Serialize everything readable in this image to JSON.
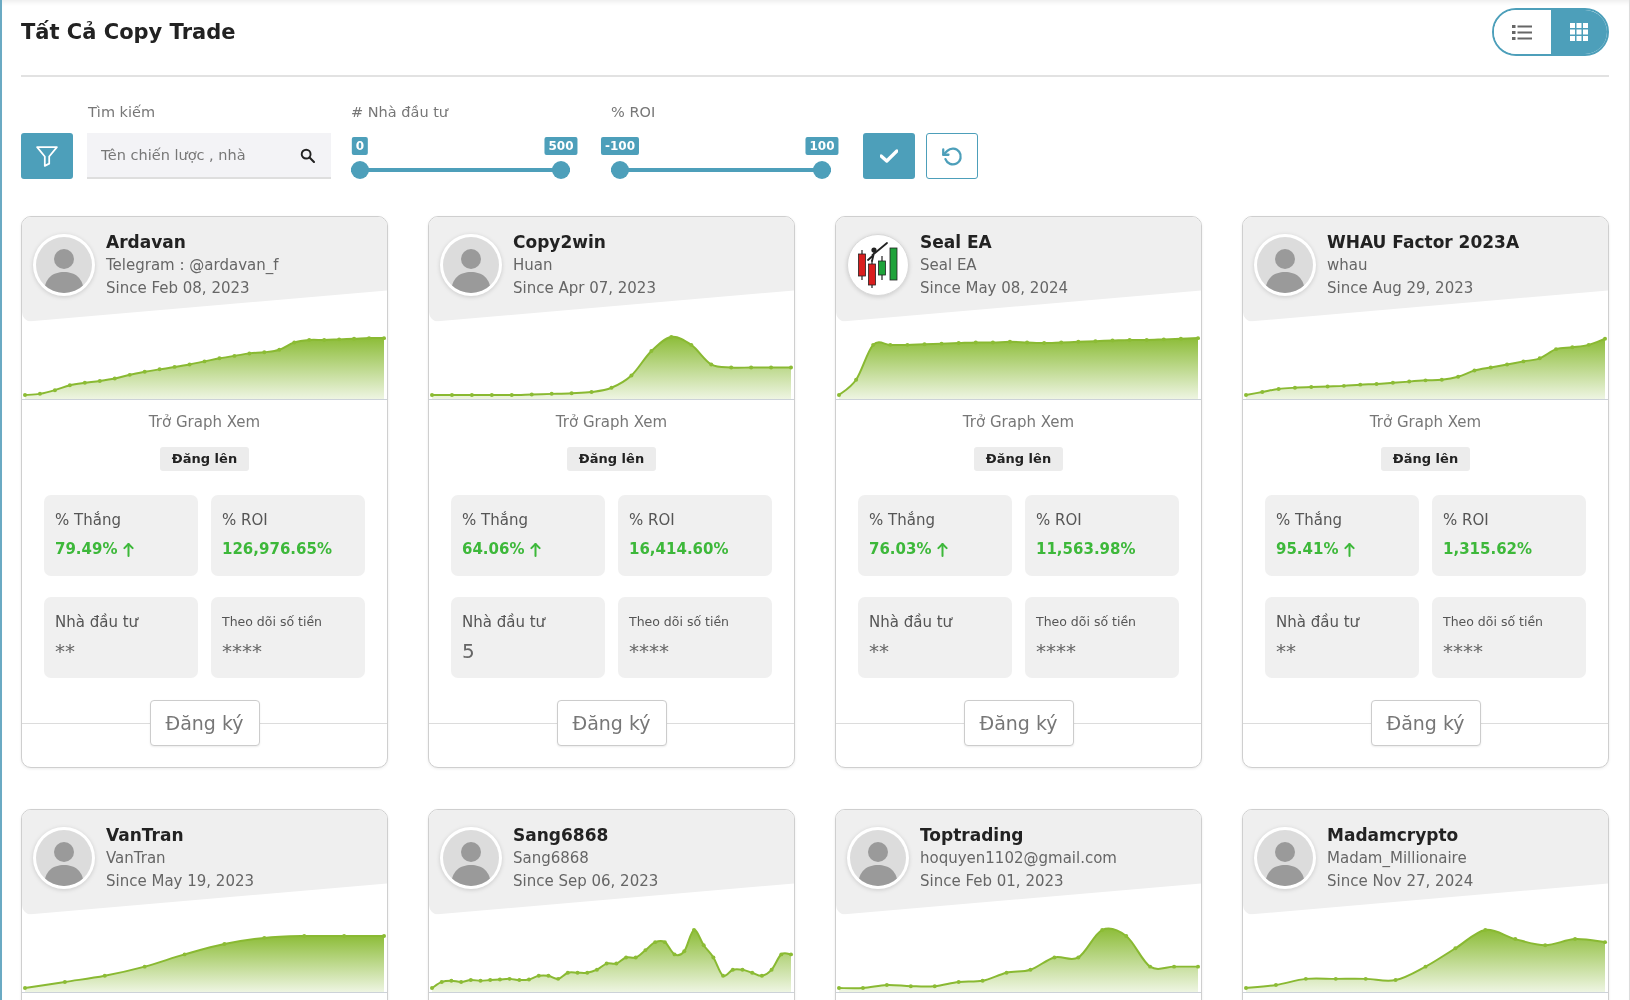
{
  "page": {
    "title": "Tất Cả Copy Trade"
  },
  "view_modes": [
    {
      "kind": "list",
      "selected": false
    },
    {
      "kind": "grid",
      "selected": true
    }
  ],
  "filters": {
    "search": {
      "label": "Tìm kiếm",
      "placeholder": "Tên chiến lược , nhà"
    },
    "sliders": [
      {
        "label": "# Nhà đầu tư",
        "min_label": "0",
        "max_label": "500",
        "level": 1
      },
      {
        "label": "% ROI",
        "min_label": "-100",
        "max_label": "100",
        "level": 1
      }
    ]
  },
  "cards": [
    {
      "name": "Ardavan",
      "subtitle": "Telegram : @ardavan_f",
      "since": "Since Feb 08, 2023",
      "avatar": {
        "kind": "person"
      },
      "caption": "Trở Graph Xem",
      "badge": "Đăng lên",
      "stats": [
        {
          "kind": "rate",
          "label": "% Thắng",
          "value": "79.49%",
          "trend_up": true
        },
        {
          "kind": "rate",
          "label": "% ROI",
          "value": "126,976.65%",
          "trend_up": false
        },
        {
          "kind": "count",
          "label": "Nhà đầu tư",
          "value": "**",
          "trend_up": false
        },
        {
          "kind": "amount",
          "label": "Theo dõi số tiền",
          "value": "****",
          "trend_up": false
        }
      ],
      "button": "Đăng ký"
    },
    {
      "name": "Copy2win",
      "subtitle": "Huan",
      "since": "Since Apr 07, 2023",
      "avatar": {
        "kind": "person"
      },
      "caption": "Trở Graph Xem",
      "badge": "Đăng lên",
      "stats": [
        {
          "kind": "rate",
          "label": "% Thắng",
          "value": "64.06%",
          "trend_up": true
        },
        {
          "kind": "rate",
          "label": "% ROI",
          "value": "16,414.60%",
          "trend_up": false
        },
        {
          "kind": "count",
          "label": "Nhà đầu tư",
          "value": "5",
          "trend_up": false
        },
        {
          "kind": "amount",
          "label": "Theo dõi số tiền",
          "value": "****",
          "trend_up": false
        }
      ],
      "button": "Đăng ký"
    },
    {
      "name": "Seal EA",
      "subtitle": "Seal EA",
      "since": "Since May 08, 2024",
      "avatar": {
        "kind": "candlestick"
      },
      "caption": "Trở Graph Xem",
      "badge": "Đăng lên",
      "stats": [
        {
          "kind": "rate",
          "label": "% Thắng",
          "value": "76.03%",
          "trend_up": true
        },
        {
          "kind": "rate",
          "label": "% ROI",
          "value": "11,563.98%",
          "trend_up": false
        },
        {
          "kind": "count",
          "label": "Nhà đầu tư",
          "value": "**",
          "trend_up": false
        },
        {
          "kind": "amount",
          "label": "Theo dõi số tiền",
          "value": "****",
          "trend_up": false
        }
      ],
      "button": "Đăng ký"
    },
    {
      "name": "WHAU Factor 2023A",
      "subtitle": "whau",
      "since": "Since Aug 29, 2023",
      "avatar": {
        "kind": "person"
      },
      "caption": "Trở Graph Xem",
      "badge": "Đăng lên",
      "stats": [
        {
          "kind": "rate",
          "label": "% Thắng",
          "value": "95.41%",
          "trend_up": true
        },
        {
          "kind": "rate",
          "label": "% ROI",
          "value": "1,315.62%",
          "trend_up": false
        },
        {
          "kind": "count",
          "label": "Nhà đầu tư",
          "value": "**",
          "trend_up": false
        },
        {
          "kind": "amount",
          "label": "Theo dõi số tiền",
          "value": "****",
          "trend_up": false
        }
      ],
      "button": "Đăng ký"
    },
    {
      "name": "VanTran",
      "subtitle": "VanTran",
      "since": "Since May 19, 2023",
      "avatar": {
        "kind": "person"
      }
    },
    {
      "name": "Sang6868",
      "subtitle": "Sang6868",
      "since": "Since Sep 06, 2023",
      "avatar": {
        "kind": "person"
      }
    },
    {
      "name": "Toptrading",
      "subtitle": "hoquyen1102@gmail.com",
      "since": "Since Feb 01, 2023",
      "avatar": {
        "kind": "person"
      }
    },
    {
      "name": "Madamcrypto",
      "subtitle": "Madam_Millionaire",
      "since": "Since Nov 27, 2024",
      "avatar": {
        "kind": "person"
      }
    }
  ]
}
